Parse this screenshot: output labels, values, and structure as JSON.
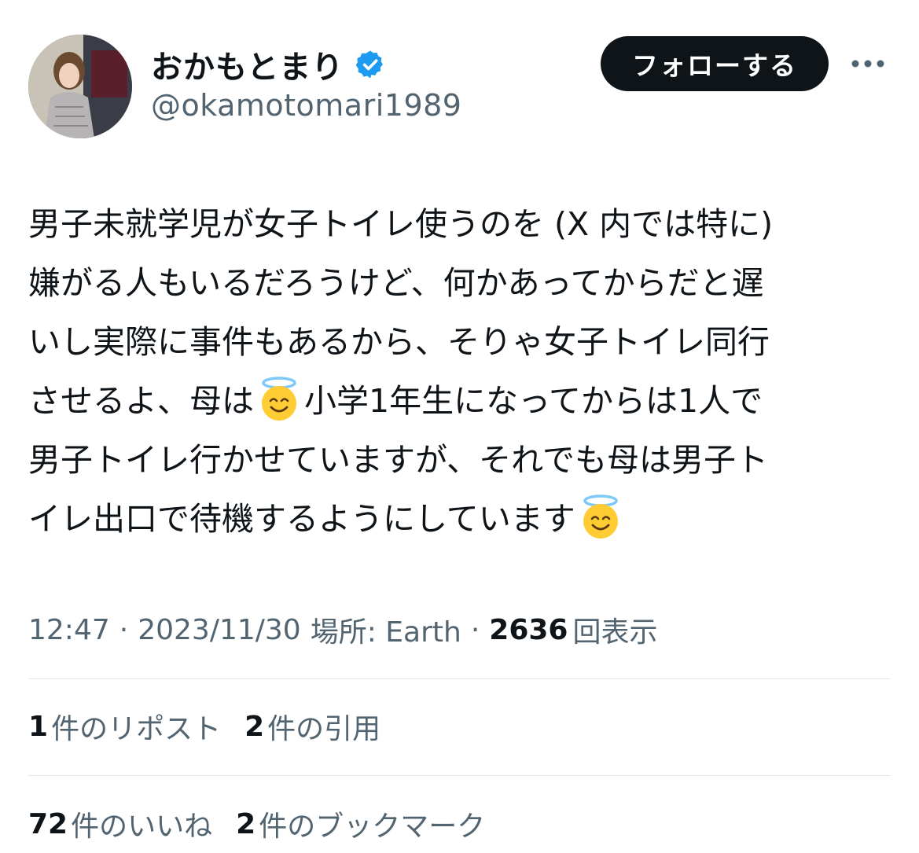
{
  "header": {
    "display_name": "おかもとまり",
    "handle": "@okamotomari1989",
    "follow_label": "フォローする",
    "accent_color": "#1d9bf0"
  },
  "tweet": {
    "lines": [
      {
        "a": "男子未就学児が女子トイレ使うのを (X 内では特に)"
      },
      {
        "a": "嫌がる人もいるだろうけど、何かあってからだと遅"
      },
      {
        "a": "いし実際に事件もあるから、そりゃ女子トイレ同行"
      },
      {
        "a": "させるよ、母は",
        "emoji": "smiling-face-with-halo",
        "b": "小学1年生になってからは1人で"
      },
      {
        "a": "男子トイレ行かせていますが、それでも母は男子ト"
      },
      {
        "a": "イレ出口で待機するようにしています",
        "emoji": "smiling-face-with-halo"
      }
    ]
  },
  "meta": {
    "time": "12:47",
    "date": "2023/11/30",
    "location_label": "場所: Earth",
    "views_count": "2636",
    "views_label": "回表示",
    "separator": "·"
  },
  "stats": {
    "reposts_count": "1",
    "reposts_label": "件のリポスト",
    "quotes_count": "2",
    "quotes_label": "件の引用",
    "likes_count": "72",
    "likes_label": "件のいいね",
    "bookmarks_count": "2",
    "bookmarks_label": "件のブックマーク"
  }
}
